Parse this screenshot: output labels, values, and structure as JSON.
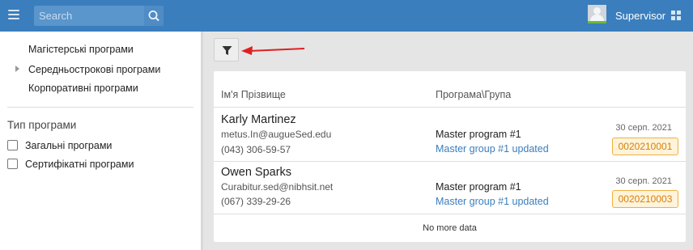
{
  "header": {
    "search_placeholder": "Search",
    "user_name": "Supervisor",
    "brand_color": "#3a7ebd"
  },
  "sidebar": {
    "items": [
      {
        "label": "Магістерські програми"
      },
      {
        "label": "Середньострокові програми",
        "expandable": true
      },
      {
        "label": "Корпоративні програми"
      }
    ],
    "filter_section_title": "Тип програми",
    "filters": [
      {
        "label": "Загальні програми",
        "checked": false
      },
      {
        "label": "Сертифікатні програми",
        "checked": false
      }
    ]
  },
  "toolbar": {
    "filter_icon": "filter-icon"
  },
  "table": {
    "col_name": "Ім'я Прізвище",
    "col_program": "Програма\\Група",
    "rows": [
      {
        "name": "Karly Martinez",
        "email": "metus.In@augueSed.edu",
        "phone": "(043) 306-59-57",
        "program": "Master program #1",
        "group": "Master group #1 updated",
        "date": "30 серп. 2021",
        "code": "0020210001"
      },
      {
        "name": "Owen Sparks",
        "email": "Curabitur.sed@nibhsit.net",
        "phone": "(067) 339-29-26",
        "program": "Master program #1",
        "group": "Master group #1 updated",
        "date": "30 серп. 2021",
        "code": "0020210003"
      }
    ],
    "footer_text": "No more data"
  }
}
